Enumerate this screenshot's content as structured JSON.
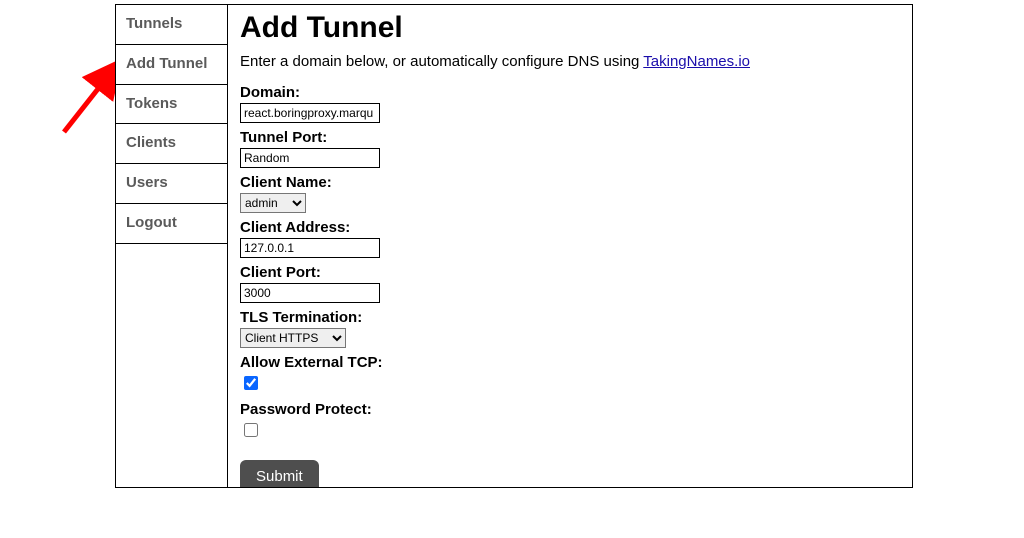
{
  "sidebar": {
    "items": [
      {
        "label": "Tunnels"
      },
      {
        "label": "Add Tunnel"
      },
      {
        "label": "Tokens"
      },
      {
        "label": "Clients"
      },
      {
        "label": "Users"
      },
      {
        "label": "Logout"
      }
    ]
  },
  "main": {
    "title": "Add Tunnel",
    "intro_prefix": "Enter a domain below, or automatically configure DNS using ",
    "intro_link_text": "TakingNames.io",
    "form": {
      "domain": {
        "label": "Domain:",
        "value": "react.boringproxy.marqu"
      },
      "tunnel_port": {
        "label": "Tunnel Port:",
        "value": "Random"
      },
      "client_name": {
        "label": "Client Name:",
        "value": "admin"
      },
      "client_address": {
        "label": "Client Address:",
        "value": "127.0.0.1"
      },
      "client_port": {
        "label": "Client Port:",
        "value": "3000"
      },
      "tls_termination": {
        "label": "TLS Termination:",
        "value": "Client HTTPS"
      },
      "allow_external_tcp": {
        "label": "Allow External TCP:",
        "checked": true
      },
      "password_protect": {
        "label": "Password Protect:",
        "checked": false
      },
      "submit_label": "Submit"
    }
  },
  "annotation": {
    "arrow_color": "#ff0000"
  }
}
